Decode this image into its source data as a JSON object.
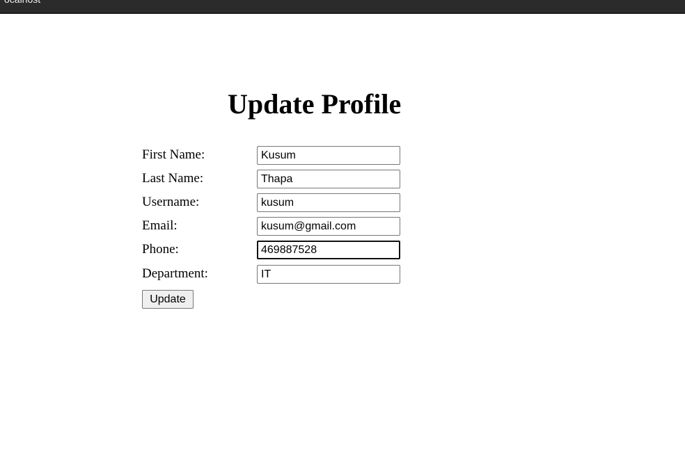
{
  "topbar": {
    "text": "ocalhost"
  },
  "page": {
    "title": "Update Profile"
  },
  "form": {
    "fields": [
      {
        "label": "First Name:",
        "value": "Kusum"
      },
      {
        "label": "Last Name:",
        "value": "Thapa"
      },
      {
        "label": "Username:",
        "value": "kusum"
      },
      {
        "label": "Email:",
        "value": "kusum@gmail.com"
      },
      {
        "label": "Phone:",
        "value": "469887528",
        "focused": true
      },
      {
        "label": "Department:",
        "value": "IT"
      }
    ],
    "submit_label": "Update"
  }
}
